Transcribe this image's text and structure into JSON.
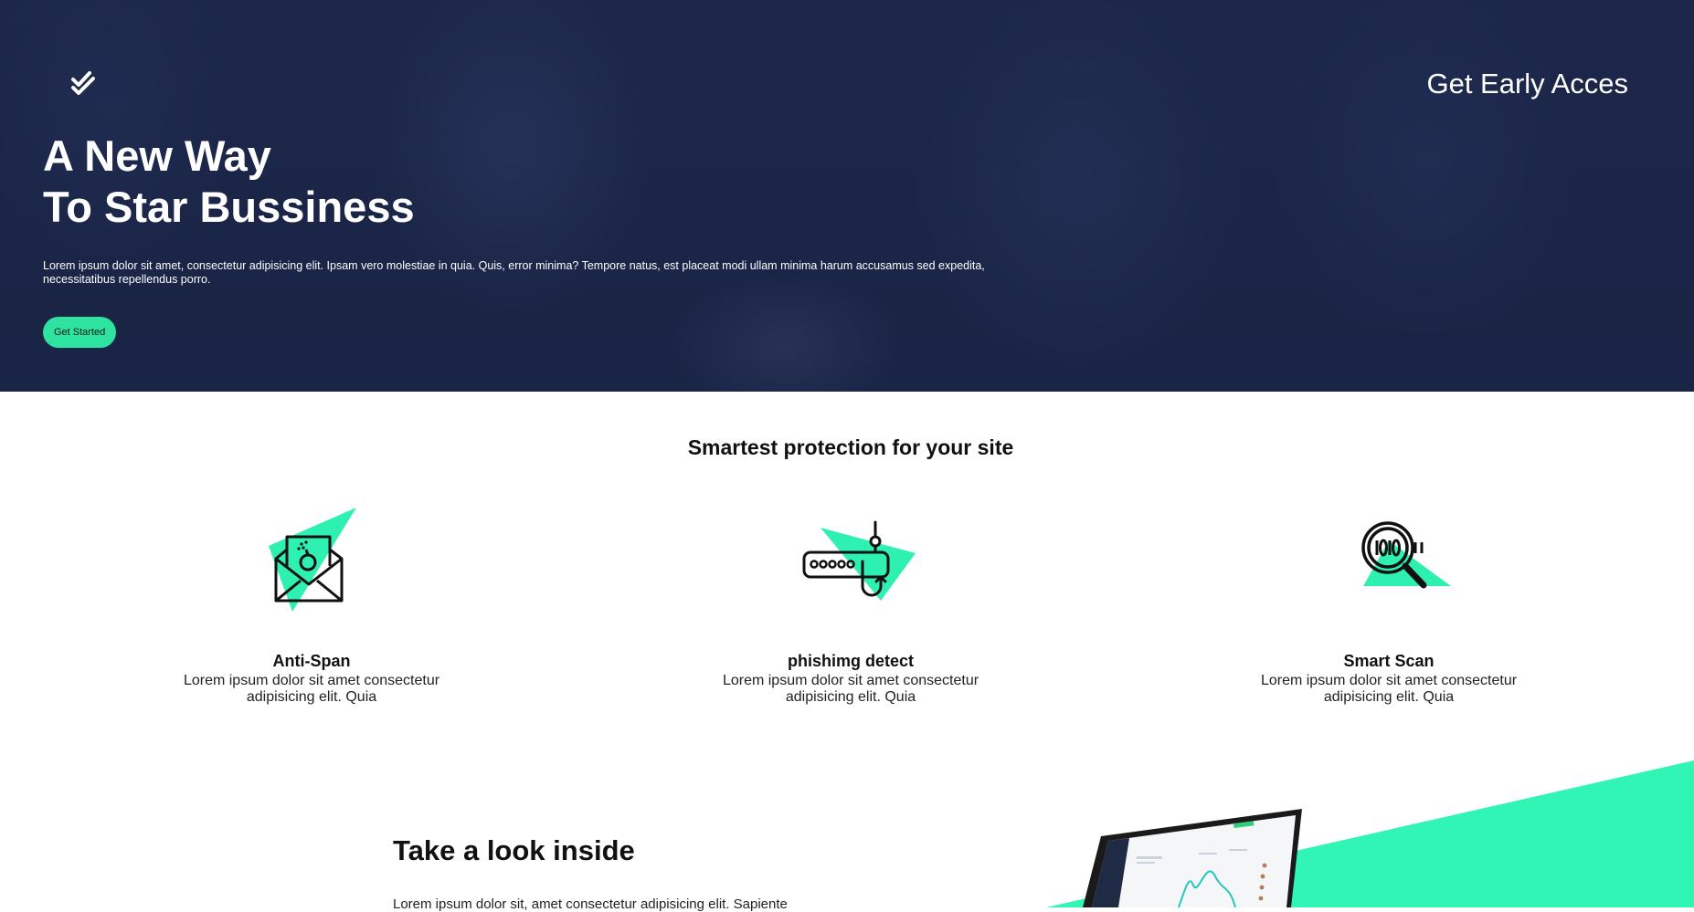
{
  "header": {
    "cta_label": "Get Early Acces",
    "logo_icon": "double-check-icon"
  },
  "hero": {
    "title_line1": "A New Way",
    "title_line2": "To Star Bussiness",
    "description": "Lorem ipsum dolor sit amet, consectetur adipisicing elit. Ipsam vero molestiae in quia. Quis, error minima? Tempore natus, est placeat modi ullam minima harum accusamus sed expedita, necessitatibus repellendus porro.",
    "button_label": "Get Started"
  },
  "features": {
    "title": "Smartest protection for your site",
    "items": [
      {
        "title": "Anti-Span",
        "text": "Lorem ipsum dolor sit amet consectetur adipisicing elit. Quia",
        "icon": "mail-bomb-icon"
      },
      {
        "title": "phishimg detect",
        "text": "Lorem ipsum dolor sit amet consectetur adipisicing elit. Quia",
        "icon": "router-hook-icon"
      },
      {
        "title": "Smart Scan",
        "text": "Lorem ipsum dolor sit amet consectetur adipisicing elit. Quia",
        "icon": "magnifier-binary-icon"
      }
    ]
  },
  "inside": {
    "title": "Take a look inside",
    "text": "Lorem ipsum dolor sit, amet consectetur adipisicing elit. Sapiente"
  },
  "colors": {
    "accent": "#2ee3a0",
    "hero_overlay": "#1e2a4d",
    "text_dark": "#111111"
  }
}
